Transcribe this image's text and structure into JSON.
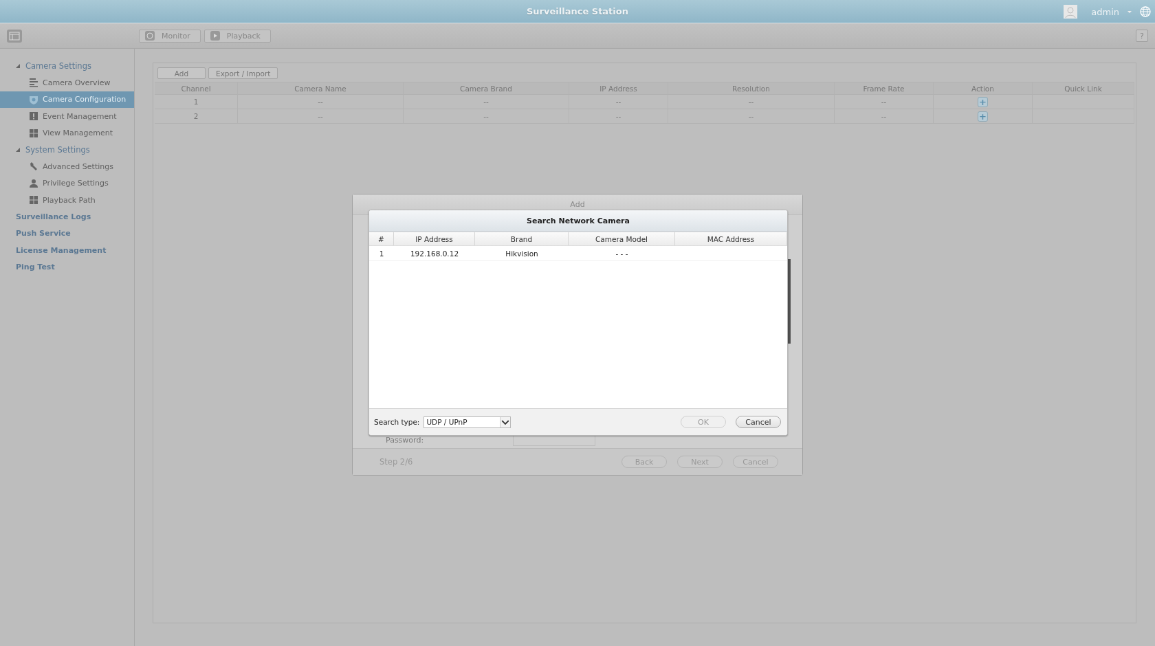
{
  "window": {
    "title": "Surveillance Station"
  },
  "user": {
    "name": "admin"
  },
  "toolbar": {
    "buttons": [
      {
        "label": "Monitor",
        "kind": "face"
      },
      {
        "label": "Playback",
        "kind": "play"
      }
    ],
    "help": "?"
  },
  "sidebar": {
    "items": [
      {
        "label": "Camera Settings",
        "kind": "group",
        "expanded": true,
        "selected": false,
        "children": [
          {
            "label": "Camera Overview",
            "kind": "list",
            "selected": false
          },
          {
            "label": "Camera Configuration",
            "kind": "shield",
            "selected": true
          },
          {
            "label": "Event Management",
            "kind": "alert",
            "selected": false
          },
          {
            "label": "View Management",
            "kind": "grid",
            "selected": false
          }
        ]
      },
      {
        "label": "System Settings",
        "kind": "group",
        "expanded": true,
        "selected": false,
        "children": [
          {
            "label": "Advanced Settings",
            "kind": "wrench",
            "selected": false
          },
          {
            "label": "Privilege Settings",
            "kind": "person",
            "selected": false
          },
          {
            "label": "Playback Path",
            "kind": "grid",
            "selected": false
          }
        ]
      },
      {
        "label": "Surveillance Logs",
        "kind": "link",
        "selected": false
      },
      {
        "label": "Push Service",
        "kind": "link",
        "selected": false
      },
      {
        "label": "License Management",
        "kind": "link",
        "selected": false
      },
      {
        "label": "Ping Test",
        "kind": "link",
        "selected": false
      }
    ]
  },
  "camera_table": {
    "buttons": [
      "Add",
      "Export / Import"
    ],
    "columns": [
      "Channel",
      "Camera Name",
      "Camera Brand",
      "IP Address",
      "Resolution",
      "Frame Rate",
      "Action",
      "Quick Link"
    ],
    "rows": [
      {
        "cells": [
          "1",
          "--",
          "--",
          "--",
          "--",
          "--"
        ],
        "action": "+"
      },
      {
        "cells": [
          "2",
          "--",
          "--",
          "--",
          "--",
          "--"
        ],
        "action": "+"
      }
    ]
  },
  "add_dialog": {
    "title": "Add",
    "password_label": "Password:",
    "step": "Step 2/6",
    "buttons": [
      "Back",
      "Next",
      "Cancel"
    ]
  },
  "search_dialog": {
    "title": "Search Network Camera",
    "columns": [
      "#",
      "IP Address",
      "Brand",
      "Camera Model",
      "MAC Address"
    ],
    "rows": [
      {
        "cells": [
          "1",
          "192.168.0.12",
          "Hikvision",
          "- - -"
        ]
      }
    ],
    "search_type_label": "Search type:",
    "search_type": "UDP / UPnP",
    "buttons": [
      {
        "label": "OK",
        "disabled": true
      },
      {
        "label": "Cancel",
        "disabled": false
      }
    ]
  }
}
